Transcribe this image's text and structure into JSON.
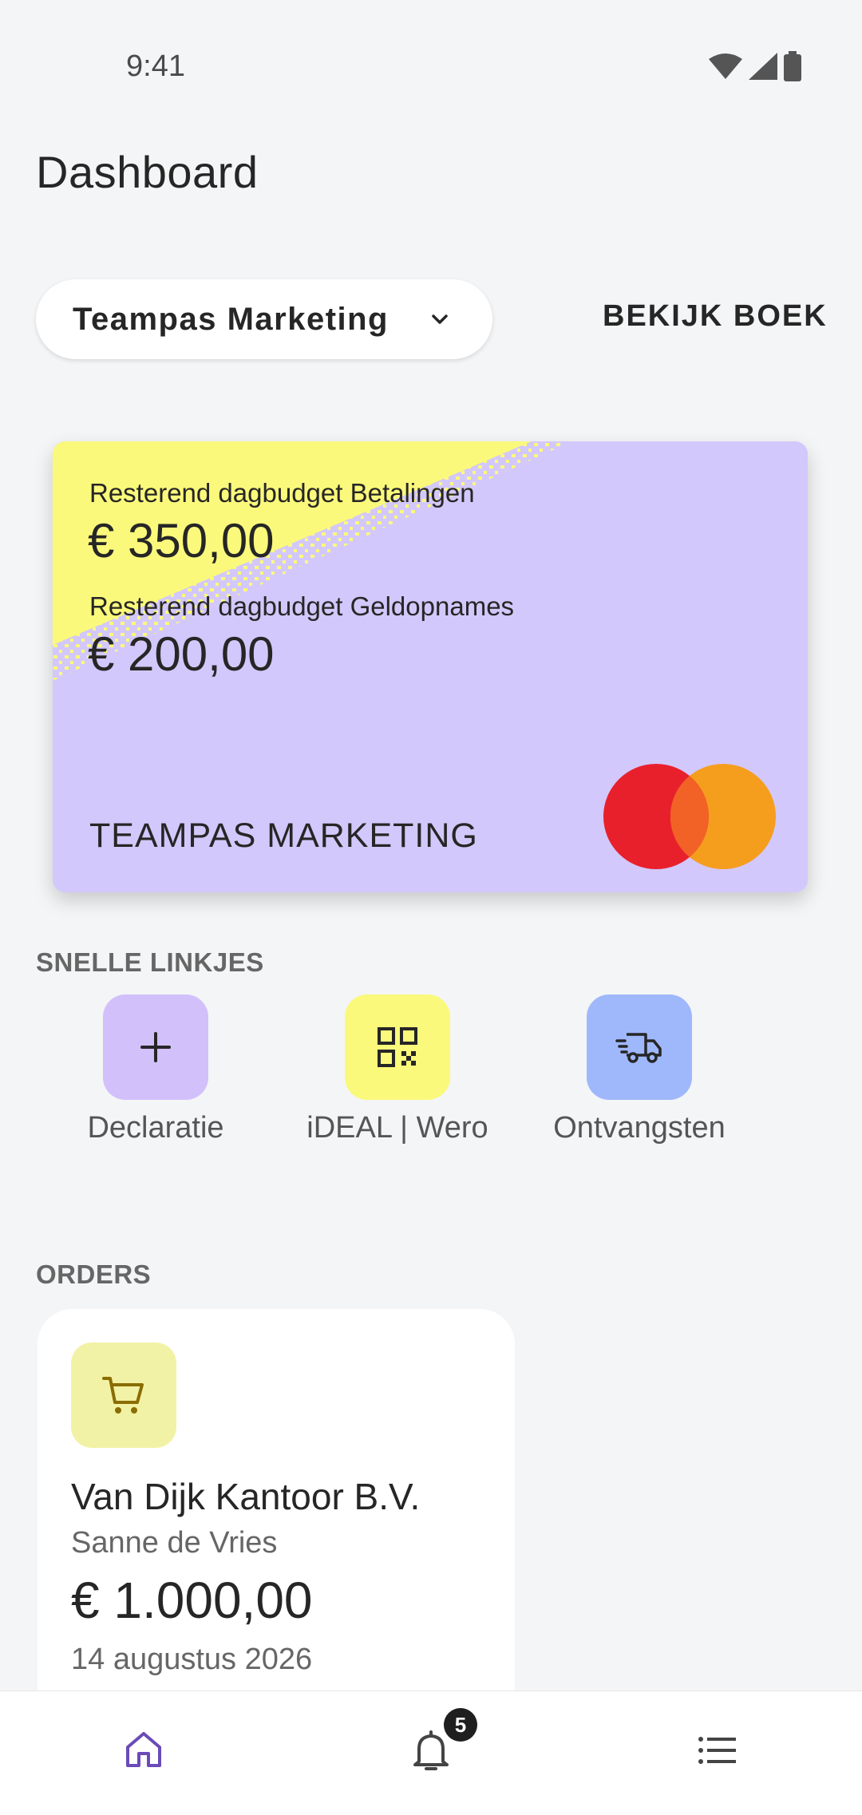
{
  "status_bar": {
    "time": "9:41"
  },
  "header": {
    "title": "Dashboard"
  },
  "account": {
    "selected": "Teampas Marketing",
    "view_book": "BEKIJK BOEK"
  },
  "card": {
    "label_payments": "Resterend dagbudget Betalingen",
    "amount_payments": "€ 350,00",
    "label_withdrawals": "Resterend dagbudget Geldopnames",
    "amount_withdrawals": "€ 200,00",
    "card_name": "TEAMPAS MARKETING",
    "colors": {
      "base": "#d3c8fb",
      "accent": "#fbf97b",
      "mc_red": "#e8202c",
      "mc_orange": "#f59e1e"
    }
  },
  "quick_links": {
    "title": "SNELLE LINKJES",
    "items": [
      {
        "label": "Declaratie",
        "icon": "plus-icon",
        "color": "#d2c0fb"
      },
      {
        "label": "iDEAL | Wero",
        "icon": "qr-code-icon",
        "color": "#fbf97b"
      },
      {
        "label": "Ontvangsten",
        "icon": "delivery-truck-icon",
        "color": "#9fb8fb"
      }
    ]
  },
  "orders": {
    "title": "ORDERS",
    "items": [
      {
        "vendor": "Van Dijk Kantoor B.V.",
        "person": "Sanne de Vries",
        "amount": "€ 1.000,00",
        "date": "14 augustus 2026",
        "icon": "shopping-cart-icon"
      }
    ]
  },
  "bottom_nav": {
    "items": [
      {
        "name": "home",
        "icon": "home-icon"
      },
      {
        "name": "notifications",
        "icon": "bell-icon",
        "badge": "5"
      },
      {
        "name": "menu",
        "icon": "list-icon"
      }
    ],
    "active_color": "#6a4bb8"
  }
}
